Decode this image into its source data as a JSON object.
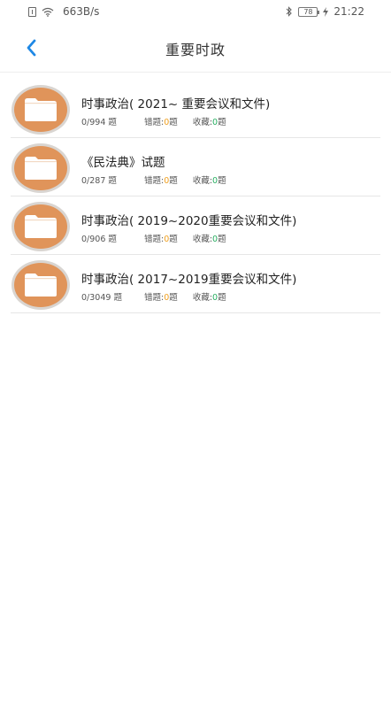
{
  "status_bar": {
    "network_speed": "663B/s",
    "battery_level": "78",
    "time": "21:22"
  },
  "header": {
    "title": "重要时政",
    "back_icon": "chevron-left-icon"
  },
  "colors": {
    "accent": "#1e88e5",
    "folder": "#e0945a",
    "wrong": "#f0a020",
    "favorite": "#27ae60"
  },
  "items": [
    {
      "title": "时事政治( 2021~  重要会议和文件)",
      "count": "0/994 题",
      "wrong_label": "错题:",
      "wrong_num": "0",
      "wrong_unit": "题",
      "fav_label": "收藏:",
      "fav_num": "0",
      "fav_unit": "题"
    },
    {
      "title": "《民法典》试题",
      "count": "0/287 题",
      "wrong_label": "错题:",
      "wrong_num": "0",
      "wrong_unit": "题",
      "fav_label": "收藏:",
      "fav_num": "0",
      "fav_unit": "题"
    },
    {
      "title": "时事政治( 2019~2020重要会议和文件)",
      "count": "0/906 题",
      "wrong_label": "错题:",
      "wrong_num": "0",
      "wrong_unit": "题",
      "fav_label": "收藏:",
      "fav_num": "0",
      "fav_unit": "题"
    },
    {
      "title": "时事政治( 2017~2019重要会议和文件)",
      "count": "0/3049 题",
      "wrong_label": "错题:",
      "wrong_num": "0",
      "wrong_unit": "题",
      "fav_label": "收藏:",
      "fav_num": "0",
      "fav_unit": "题"
    }
  ]
}
